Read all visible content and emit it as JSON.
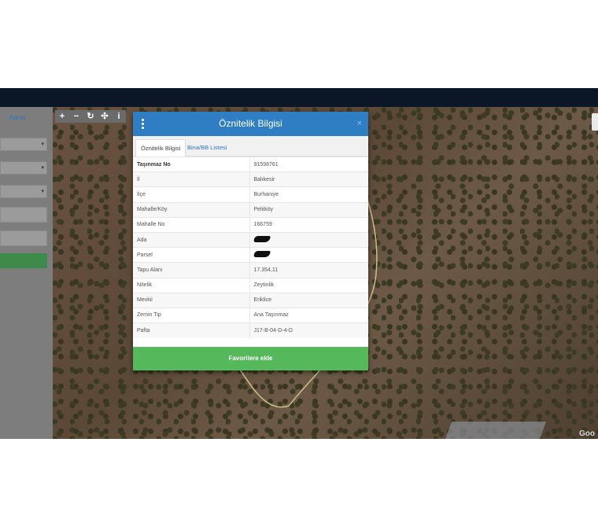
{
  "sidebar": {
    "tab_label": "Adres"
  },
  "map_tools": {
    "zoom_in": "+",
    "zoom_out": "−",
    "refresh": "↻",
    "locate": "✣",
    "info": "i"
  },
  "map": {
    "attribution": "Goo"
  },
  "modal": {
    "title": "Öznitelik Bilgisi",
    "close": "×",
    "tabs": [
      "Öznitelik Bilgisi",
      "Bina/BB Listesi"
    ],
    "rows": [
      {
        "key": "Taşınmaz No",
        "value": "91598761"
      },
      {
        "key": "İl",
        "value": "Balıkesir"
      },
      {
        "key": "İlçe",
        "value": "Burhaniye"
      },
      {
        "key": "Mahalle/Köy",
        "value": "Pelitköy"
      },
      {
        "key": "Mahalle No",
        "value": "166759"
      },
      {
        "key": "Ada",
        "value": ""
      },
      {
        "key": "Parsel",
        "value": ""
      },
      {
        "key": "Tapu Alanı",
        "value": "17.354,11"
      },
      {
        "key": "Nitelik",
        "value": "Zeytinlik"
      },
      {
        "key": "Mevkii",
        "value": "Eriklice"
      },
      {
        "key": "Zemin Tip",
        "value": "Ana Taşınmaz"
      },
      {
        "key": "Pafta",
        "value": "J17-B-04-D-4-D"
      }
    ],
    "button_label": "Favorilere ekle"
  },
  "colors": {
    "header": "#2f7ec4",
    "button": "#55b95c",
    "topbar": "#0b1726"
  }
}
